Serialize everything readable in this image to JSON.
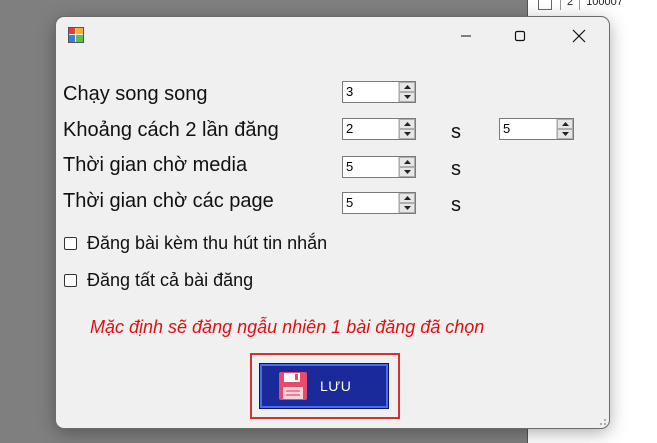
{
  "background_app": {
    "row_number": "2",
    "row_value": "100007"
  },
  "dialog": {
    "title": ""
  },
  "settings": {
    "parallel": {
      "label": "Chạy song song",
      "value": "3"
    },
    "post_interval": {
      "label": "Khoảng cách 2 lần đăng",
      "value_min": "2",
      "unit": "s",
      "value_max": "5"
    },
    "media_wait": {
      "label": "Thời gian chờ media",
      "value": "5",
      "unit": "s"
    },
    "page_wait": {
      "label": "Thời gian chờ các page",
      "value": "5",
      "unit": "s"
    }
  },
  "options": {
    "attract_messages": {
      "label": "Đăng bài kèm thu hút tin nhắn",
      "checked": false
    },
    "post_all": {
      "label": "Đăng tất cả bài đăng",
      "checked": false
    }
  },
  "note": "Mặc định sẽ đăng ngẫu nhiên 1 bài đăng đã chọn",
  "save_button": {
    "label": "LƯU",
    "icon": "floppy-disk-icon"
  },
  "colors": {
    "note_red": "#e01010",
    "button_bg": "#1a2a9a",
    "highlight": "#d63031"
  }
}
